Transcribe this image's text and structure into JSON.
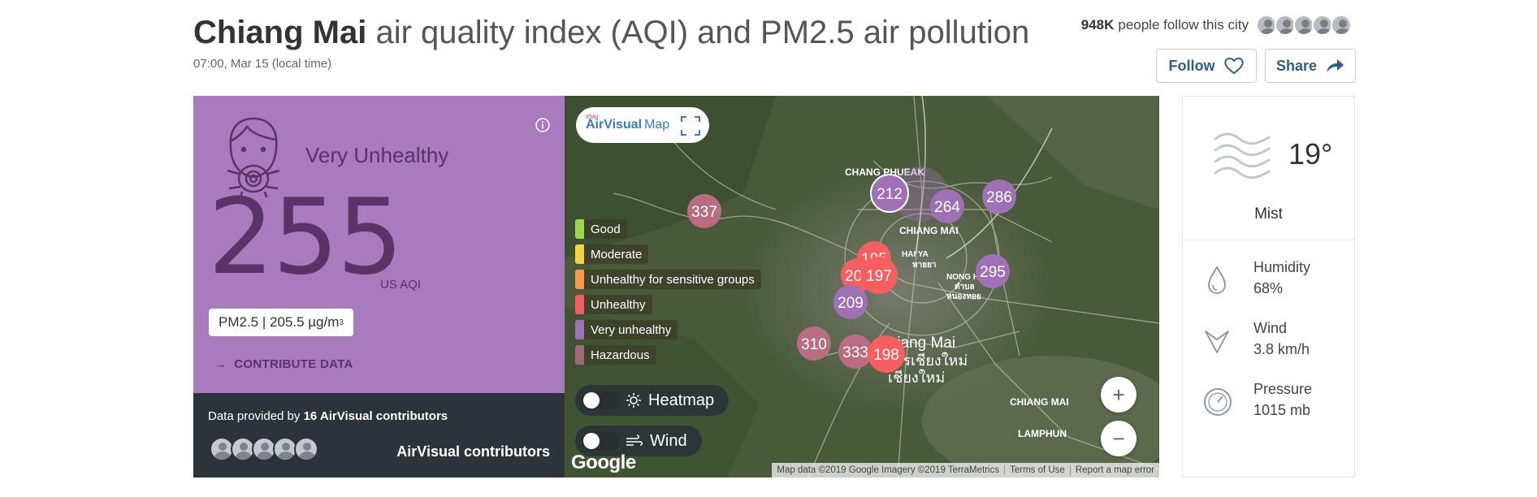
{
  "header": {
    "city": "Chiang Mai",
    "title_rest": " air quality index (AQI) and PM2.5 air pollution",
    "local_time": "07:00, Mar 15 (local time)",
    "followers_count": "948K",
    "followers_text": "people follow this city",
    "follow_label": "Follow",
    "share_label": "Share"
  },
  "aqi": {
    "level": "Very Unhealthy",
    "value": "255",
    "unit": "US AQI",
    "pm_text": "PM2.5 | 205.5 µg/m",
    "pm_exp": "3",
    "contribute": "CONTRIBUTE DATA",
    "panel_color": "#a77bbd",
    "text_color": "#5a3466"
  },
  "provider": {
    "prefix": "Data provided by ",
    "count_text": "16 AirVisual contributors",
    "label": "AirVisual contributors"
  },
  "map": {
    "logo_tiny": "IQAir",
    "logo_brand": "AirVisual",
    "logo_map": "Map",
    "legend": [
      {
        "label": "Good",
        "color": "#9bd84e"
      },
      {
        "label": "Moderate",
        "color": "#f5d33a"
      },
      {
        "label": "Unhealthy for sensitive groups",
        "color": "#f49a4d"
      },
      {
        "label": "Unhealthy",
        "color": "#f65e5f"
      },
      {
        "label": "Very unhealthy",
        "color": "#a070b6"
      },
      {
        "label": "Hazardous",
        "color": "#a06a7b"
      }
    ],
    "heatmap_label": "Heatmap",
    "wind_label": "Wind",
    "zoom_in": "+",
    "zoom_out": "−",
    "google": "Google",
    "attribution": {
      "data": "Map data ©2019 Google Imagery ©2019 TerraMetrics",
      "terms": "Terms of Use",
      "report": "Report a map error"
    },
    "place_labels": {
      "chang_phueak": "CHANG PHUEAK",
      "chiang_mai_center": "CHIANG MAI",
      "hai_ya": "HAI YA",
      "hai_ya_thai": "หายยา",
      "nong_hoi": "NONG HOI",
      "nong_hoi_thai_1": "ตำบล",
      "nong_hoi_thai_2": "หนองหอย",
      "chiang_mai_big": "Chiang Mai",
      "chiang_mai_thai_1": "นครเชียงใหม่",
      "chiang_mai_thai_2": "เชียงใหม่",
      "chiang_mai_east": "CHIANG MAI",
      "lamphun": "LAMPHUN"
    },
    "markers": [
      {
        "value": "337",
        "color": "#b86e80"
      },
      {
        "value": "212",
        "color": "#a070b6"
      },
      {
        "value": "264",
        "color": "#a070b6"
      },
      {
        "value": "286",
        "color": "#a070b6"
      },
      {
        "value": "195",
        "color": "#f65e5f"
      },
      {
        "value": "200",
        "color": "#f65e5f"
      },
      {
        "value": "197",
        "color": "#f65e5f"
      },
      {
        "value": "295",
        "color": "#a070b6"
      },
      {
        "value": "209",
        "color": "#a070b6"
      },
      {
        "value": "310",
        "color": "#b86e80"
      },
      {
        "value": "333",
        "color": "#b86e80"
      },
      {
        "value": "198",
        "color": "#f65e5f"
      }
    ]
  },
  "weather": {
    "temperature": "19°",
    "condition": "Mist",
    "humidity_label": "Humidity",
    "humidity_value": "68%",
    "wind_label": "Wind",
    "wind_value": "3.8 km/h",
    "pressure_label": "Pressure",
    "pressure_value": "1015 mb"
  }
}
